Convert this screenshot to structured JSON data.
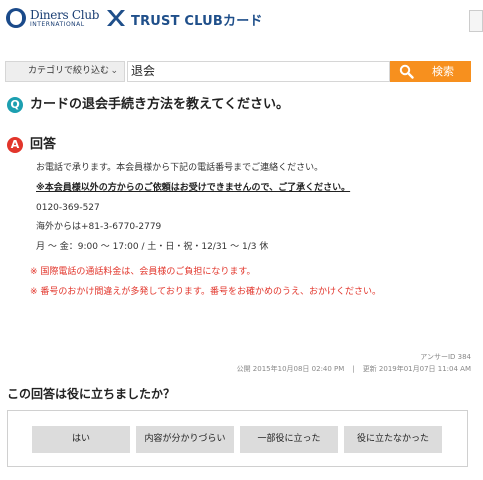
{
  "header": {
    "diners_name": "Diners Club",
    "diners_sub": "INTERNATIONAL",
    "trust_name": "TRUST CLUBカード"
  },
  "search": {
    "category_label": "カテゴリで絞り込む",
    "query": "退会",
    "button_label": "検索"
  },
  "question": {
    "badge": "Q",
    "text": "カードの退会手続き方法を教えてください。"
  },
  "answer": {
    "badge": "A",
    "title": "回答",
    "lines": [
      "お電話で承ります。本会員様から下記の電話番号までご連絡ください。",
      "※本会員様以外の方からのご依頼はお受けできませんので、ご了承ください。",
      "0120-369-527",
      "海外からは+81-3-6770-2779",
      "月 ～ 金：9:00 ～ 17:00 / 土・日・祝・12/31 ～ 1/3 休",
      "※ 国際電話の通話料金は、会員様のご負担になります。",
      "※ 番号のおかけ間違えが多発しております。番号をお確かめのうえ、おかけください。"
    ]
  },
  "meta": {
    "answer_id": "アンサーID 384",
    "published": "公開 2015年10月08日 02:40 PM",
    "separator": "|",
    "updated": "更新 2019年01月07日 11:04 AM"
  },
  "feedback": {
    "title": "この回答は役に立ちましたか？",
    "buttons": [
      "はい",
      "内容が分かりづらい",
      "一部役に立った",
      "役に立たなかった"
    ]
  }
}
